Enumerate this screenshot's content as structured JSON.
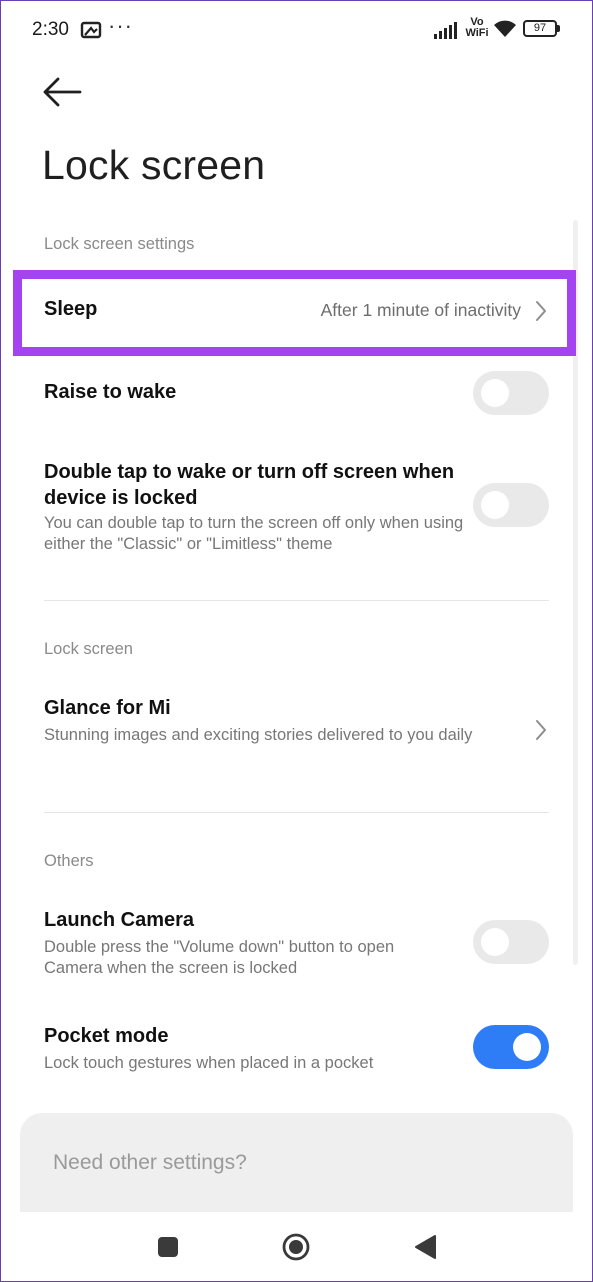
{
  "status_bar": {
    "time": "2:30",
    "dots": "···",
    "volte": "Vo",
    "wifi_label": "WiFi",
    "battery": "97",
    "icons": [
      "picture-in-picture-icon",
      "more-dots-icon",
      "signal-icon",
      "vowifi-icon",
      "wifi-icon",
      "battery-icon"
    ]
  },
  "page": {
    "title": "Lock screen"
  },
  "sections": {
    "lock_screen_settings": {
      "label": "Lock screen settings",
      "sleep": {
        "title": "Sleep",
        "value": "After 1 minute of inactivity",
        "highlight_color": "#a443f0"
      },
      "raise_to_wake": {
        "title": "Raise to wake",
        "enabled": false
      },
      "double_tap": {
        "title": "Double tap to wake or turn off screen when device is locked",
        "subtitle": "You can double tap to turn the screen off only when using either the \"Classic\" or \"Limitless\" theme",
        "enabled": false
      }
    },
    "lock_screen": {
      "label": "Lock screen",
      "glance": {
        "title": "Glance for Mi",
        "subtitle": "Stunning images and exciting stories delivered to you daily"
      }
    },
    "others": {
      "label": "Others",
      "launch_camera": {
        "title": "Launch Camera",
        "subtitle": "Double press the \"Volume down\" button to open Camera when the screen is locked",
        "enabled": false
      },
      "pocket_mode": {
        "title": "Pocket mode",
        "subtitle": "Lock touch gestures when placed in a pocket",
        "enabled": true
      }
    }
  },
  "footer_card": {
    "text": "Need other settings?"
  },
  "colors": {
    "accent": "#2f7df6",
    "toggle_off": "#e9e9e9",
    "highlight": "#a443f0"
  }
}
